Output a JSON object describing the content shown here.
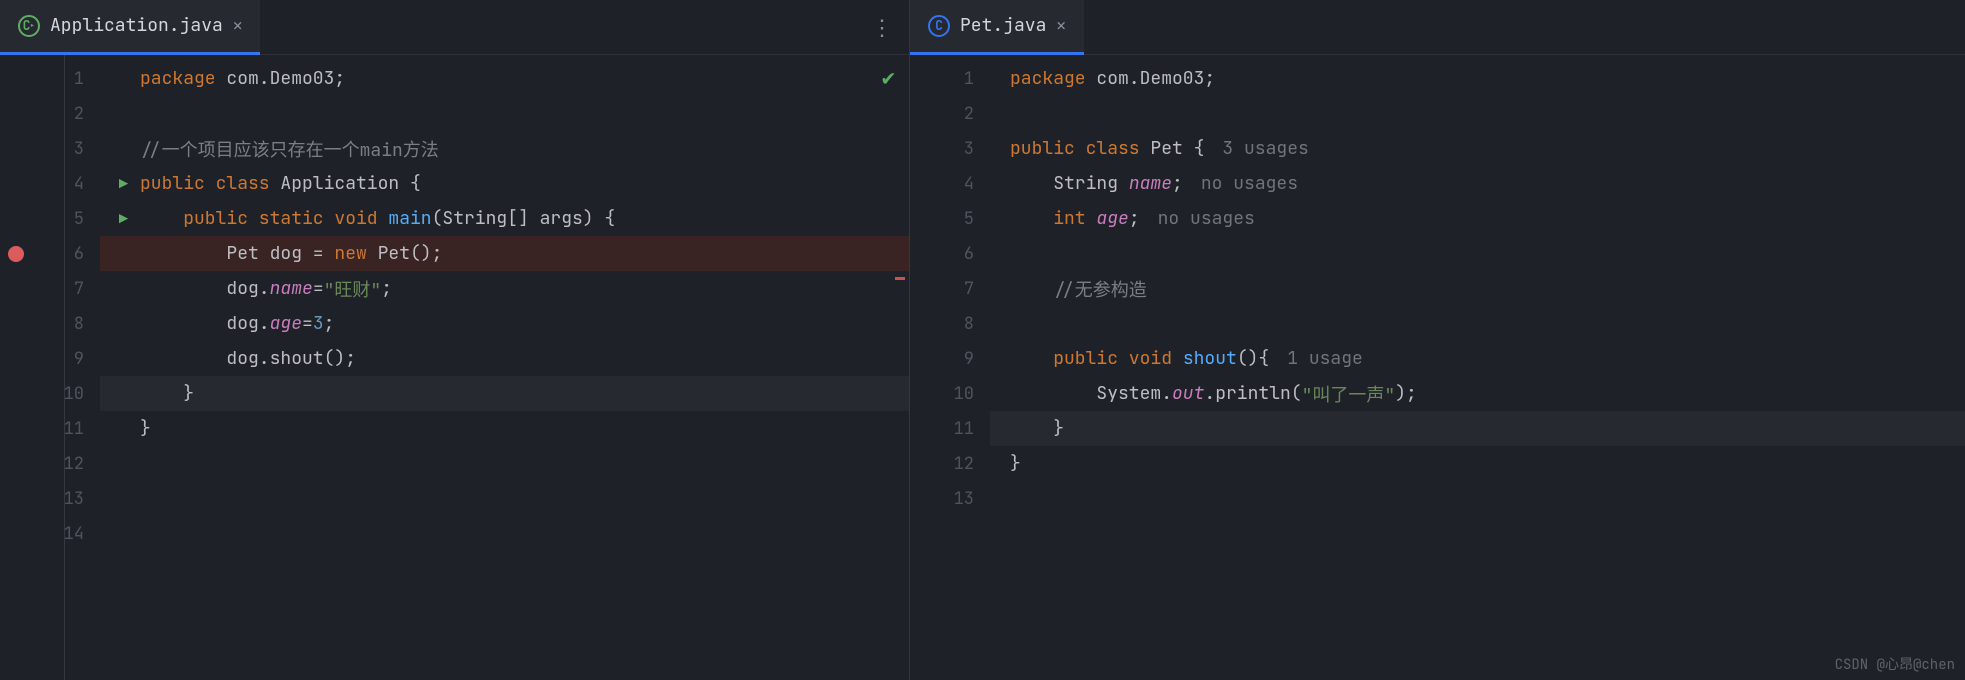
{
  "left": {
    "tab": {
      "filename": "Application.java",
      "icon_letter": "C"
    },
    "lines": [
      {
        "n": 1,
        "tokens": [
          {
            "c": "kw",
            "t": "package "
          },
          {
            "c": "plain",
            "t": "com.Demo03;"
          }
        ]
      },
      {
        "n": 2,
        "tokens": []
      },
      {
        "n": 3,
        "tokens": [
          {
            "c": "cm",
            "t": "//一个项目应该只存在一个main方法"
          }
        ]
      },
      {
        "n": 4,
        "run": true,
        "tokens": [
          {
            "c": "kw",
            "t": "public class "
          },
          {
            "c": "plain",
            "t": "Application {"
          }
        ]
      },
      {
        "n": 5,
        "run": true,
        "tokens": [
          {
            "c": "plain",
            "t": "    "
          },
          {
            "c": "kw",
            "t": "public static void "
          },
          {
            "c": "fn",
            "t": "main"
          },
          {
            "c": "plain",
            "t": "(String[] args) {"
          }
        ]
      },
      {
        "n": 6,
        "bp": true,
        "hl": "bp",
        "tokens": [
          {
            "c": "plain",
            "t": "        Pet dog = "
          },
          {
            "c": "kw",
            "t": "new "
          },
          {
            "c": "plain",
            "t": "Pet();"
          }
        ]
      },
      {
        "n": 7,
        "tokens": [
          {
            "c": "plain",
            "t": "        dog."
          },
          {
            "c": "fld",
            "t": "name"
          },
          {
            "c": "plain",
            "t": "="
          },
          {
            "c": "str",
            "t": "\"旺财\""
          },
          {
            "c": "plain",
            "t": ";"
          }
        ]
      },
      {
        "n": 8,
        "tokens": [
          {
            "c": "plain",
            "t": "        dog."
          },
          {
            "c": "fld",
            "t": "age"
          },
          {
            "c": "plain",
            "t": "="
          },
          {
            "c": "num",
            "t": "3"
          },
          {
            "c": "plain",
            "t": ";"
          }
        ]
      },
      {
        "n": 9,
        "tokens": [
          {
            "c": "plain",
            "t": "        dog.shout();"
          }
        ]
      },
      {
        "n": 10,
        "hl": "cur",
        "tokens": [
          {
            "c": "plain",
            "t": "    }"
          }
        ]
      },
      {
        "n": 11,
        "tokens": [
          {
            "c": "plain",
            "t": "}"
          }
        ]
      },
      {
        "n": 12,
        "tokens": []
      },
      {
        "n": 13,
        "tokens": []
      },
      {
        "n": 14,
        "tokens": []
      }
    ]
  },
  "right": {
    "tab": {
      "filename": "Pet.java",
      "icon_letter": "C"
    },
    "lines": [
      {
        "n": 1,
        "tokens": [
          {
            "c": "kw",
            "t": "package "
          },
          {
            "c": "plain",
            "t": "com.Demo03;"
          }
        ]
      },
      {
        "n": 2,
        "tokens": []
      },
      {
        "n": 3,
        "tokens": [
          {
            "c": "kw",
            "t": "public class "
          },
          {
            "c": "plain",
            "t": "Pet {"
          },
          {
            "c": "hint",
            "t": "3 usages"
          }
        ]
      },
      {
        "n": 4,
        "tokens": [
          {
            "c": "plain",
            "t": "    String "
          },
          {
            "c": "fld",
            "t": "name"
          },
          {
            "c": "plain",
            "t": ";"
          },
          {
            "c": "hint",
            "t": "no usages"
          }
        ]
      },
      {
        "n": 5,
        "tokens": [
          {
            "c": "plain",
            "t": "    "
          },
          {
            "c": "kw",
            "t": "int "
          },
          {
            "c": "fld",
            "t": "age"
          },
          {
            "c": "plain",
            "t": ";"
          },
          {
            "c": "hint",
            "t": "no usages"
          }
        ]
      },
      {
        "n": 6,
        "tokens": []
      },
      {
        "n": 7,
        "tokens": [
          {
            "c": "plain",
            "t": "    "
          },
          {
            "c": "cm",
            "t": "//无参构造"
          }
        ]
      },
      {
        "n": 8,
        "tokens": []
      },
      {
        "n": 9,
        "tokens": [
          {
            "c": "plain",
            "t": "    "
          },
          {
            "c": "kw",
            "t": "public void "
          },
          {
            "c": "fn",
            "t": "shout"
          },
          {
            "c": "plain",
            "t": "(){"
          },
          {
            "c": "hint",
            "t": "1 usage"
          }
        ]
      },
      {
        "n": 10,
        "tokens": [
          {
            "c": "plain",
            "t": "        System."
          },
          {
            "c": "st",
            "t": "out"
          },
          {
            "c": "plain",
            "t": ".println("
          },
          {
            "c": "str",
            "t": "\"叫了一声\""
          },
          {
            "c": "plain",
            "t": ");"
          }
        ]
      },
      {
        "n": 11,
        "hl": "cur",
        "tokens": [
          {
            "c": "plain",
            "t": "    }"
          }
        ]
      },
      {
        "n": 12,
        "tokens": [
          {
            "c": "plain",
            "t": "}"
          }
        ]
      },
      {
        "n": 13,
        "tokens": []
      }
    ]
  },
  "watermark": "CSDN @心昂@chen"
}
